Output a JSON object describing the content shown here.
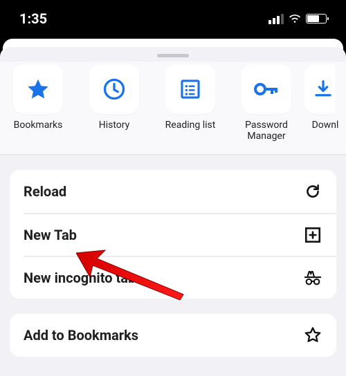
{
  "statusbar": {
    "time": "1:35"
  },
  "colors": {
    "accent": "#1a73e8"
  },
  "shortcuts": [
    {
      "icon": "star",
      "label": "Bookmarks"
    },
    {
      "icon": "clock",
      "label": "History"
    },
    {
      "icon": "list",
      "label": "Reading list"
    },
    {
      "icon": "key",
      "label": "Password\nManager"
    },
    {
      "icon": "download",
      "label": "Downl"
    }
  ],
  "menu_group1": [
    {
      "icon": "reload",
      "label": "Reload"
    },
    {
      "icon": "plus-box",
      "label": "New Tab"
    },
    {
      "icon": "incognito",
      "label": "New incognito tab"
    }
  ],
  "menu_group2": [
    {
      "icon": "star-outline",
      "label": "Add to Bookmarks"
    }
  ]
}
